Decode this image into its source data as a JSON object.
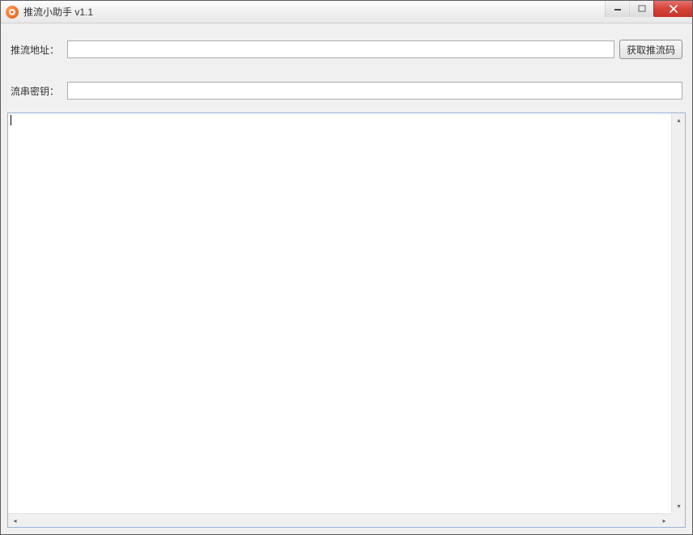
{
  "window": {
    "title": "推流小助手 v1.1"
  },
  "form": {
    "stream_url_label": "推流地址：",
    "stream_url_value": "",
    "get_code_button": "获取推流码",
    "stream_key_label": "流串密钥：",
    "stream_key_value": ""
  },
  "log": {
    "content": ""
  }
}
